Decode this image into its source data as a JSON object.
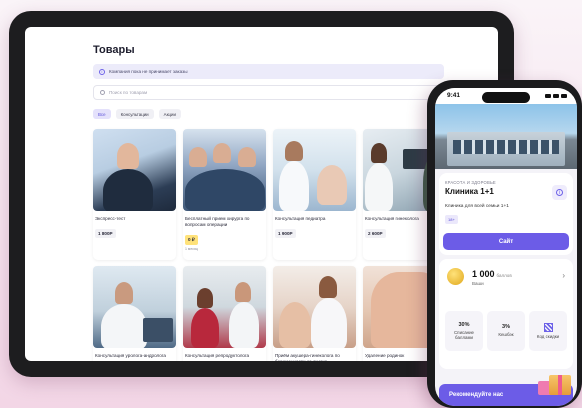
{
  "tablet": {
    "title": "Товары",
    "notice": "Компания пока не принимает заказы",
    "search_placeholder": "Поиск по товарам",
    "chips": [
      "Все",
      "Консультации",
      "Акции"
    ],
    "products": [
      {
        "name": "Экспресс-тест",
        "price": "1 800Р"
      },
      {
        "name": "Бесплатный прием хирурга по вопросам операции",
        "price": "0 ₽",
        "note": "1 месяц"
      },
      {
        "name": "Консультация педиатра",
        "price": "1 900Р"
      },
      {
        "name": "Консультация гинеколога",
        "price": "2 600Р"
      },
      {
        "name": "Консультация уролога-андролога"
      },
      {
        "name": "Консультация репродуктолога"
      },
      {
        "name": "Приём акушера-гинеколога по беременности со скидко..."
      },
      {
        "name": "Удаление родинок"
      }
    ]
  },
  "phone": {
    "time": "9:41",
    "category": "КРАСОТА И ЗДОРОВЬЕ",
    "store_name": "Клиника 1+1",
    "store_desc": "Клиника для всей семьи 1+1",
    "age": "18+",
    "site_button": "Сайт",
    "bonus_amount": "1 000",
    "bonus_unit": "баллов",
    "bonus_sub": "Ваши",
    "tiles": [
      {
        "big": "30%",
        "label": "Списание баллами"
      },
      {
        "big": "3%",
        "label": "Кешбэк"
      },
      {
        "icon": "qr-icon",
        "label": "Код скидки"
      }
    ],
    "recommend_button": "Рекомендуйте нас"
  }
}
